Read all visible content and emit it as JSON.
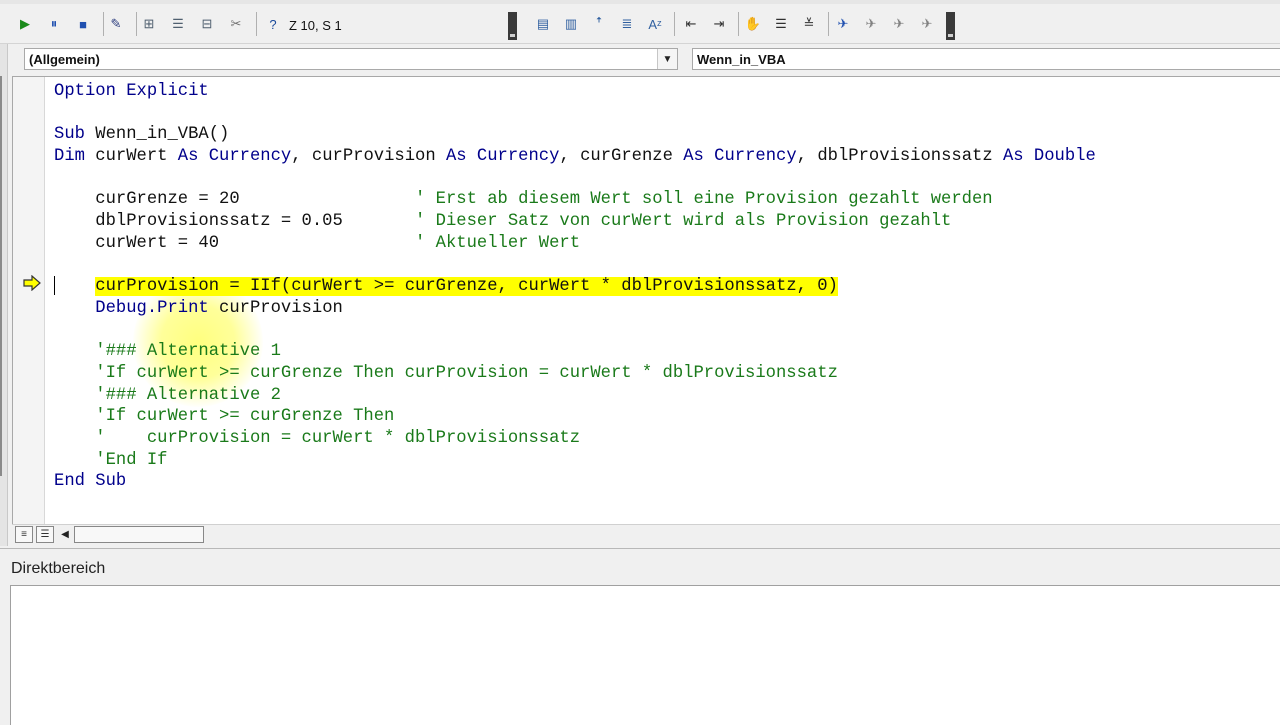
{
  "toolbar": {
    "position_indicator": "Z 10, S 1",
    "buttons_left": [
      {
        "name": "run-icon",
        "glyph": "▶",
        "color": "#1a8a1a"
      },
      {
        "name": "pause-icon",
        "glyph": "⏸",
        "color": "#2050b0"
      },
      {
        "name": "reset-icon",
        "glyph": "■",
        "color": "#2050b0"
      },
      {
        "name": "design-mode-icon",
        "glyph": "✎",
        "color": "#304080"
      },
      {
        "name": "project-explorer-icon",
        "glyph": "⊞",
        "color": "#506070"
      },
      {
        "name": "properties-icon",
        "glyph": "☰",
        "color": "#506070"
      },
      {
        "name": "object-browser-icon",
        "glyph": "⊟",
        "color": "#506070"
      },
      {
        "name": "toolbox-icon",
        "glyph": "✂",
        "color": "#707070"
      },
      {
        "name": "help-icon",
        "glyph": "?",
        "color": "#1a4a9a"
      }
    ],
    "buttons_right": [
      {
        "name": "list-properties-icon",
        "glyph": "▤",
        "color": "#3060a0"
      },
      {
        "name": "list-constants-icon",
        "glyph": "▥",
        "color": "#3060a0"
      },
      {
        "name": "quick-info-icon",
        "glyph": "ꜛ",
        "color": "#3060a0"
      },
      {
        "name": "parameter-info-icon",
        "glyph": "≣",
        "color": "#3060a0"
      },
      {
        "name": "complete-word-icon",
        "glyph": "Aᶻ",
        "color": "#3060a0"
      },
      {
        "name": "outdent-icon",
        "glyph": "⇤",
        "color": "#303030"
      },
      {
        "name": "indent-icon",
        "glyph": "⇥",
        "color": "#303030"
      },
      {
        "name": "toggle-breakpoint-icon",
        "glyph": "✋",
        "color": "#603010"
      },
      {
        "name": "comment-block-icon",
        "glyph": "☰",
        "color": "#303030"
      },
      {
        "name": "uncomment-block-icon",
        "glyph": "≚",
        "color": "#303030"
      },
      {
        "name": "toggle-bookmark-icon",
        "glyph": "✈",
        "color": "#2050b0"
      },
      {
        "name": "next-bookmark-icon",
        "glyph": "✈",
        "color": "#808080"
      },
      {
        "name": "previous-bookmark-icon",
        "glyph": "✈",
        "color": "#808080"
      },
      {
        "name": "clear-bookmarks-icon",
        "glyph": "✈",
        "color": "#808080"
      }
    ]
  },
  "module": {
    "object_combo": "(Allgemein)",
    "procedure_combo": "Wenn_in_VBA"
  },
  "code_lines": [
    [
      {
        "t": "Option Explicit",
        "c": "kw"
      }
    ],
    [],
    [
      {
        "t": "Sub ",
        "c": "kw"
      },
      {
        "t": "Wenn_in_VBA()",
        "c": ""
      }
    ],
    [
      {
        "t": "Dim ",
        "c": "kw"
      },
      {
        "t": "curWert ",
        "c": ""
      },
      {
        "t": "As Currency",
        "c": "kw"
      },
      {
        "t": ", curProvision ",
        "c": ""
      },
      {
        "t": "As Currency",
        "c": "kw"
      },
      {
        "t": ", curGrenze ",
        "c": ""
      },
      {
        "t": "As Currency",
        "c": "kw"
      },
      {
        "t": ", dblProvisionssatz ",
        "c": ""
      },
      {
        "t": "As Double",
        "c": "kw"
      }
    ],
    [],
    [
      {
        "t": "    curGrenze = 20                 ",
        "c": ""
      },
      {
        "t": "' Erst ab diesem Wert soll eine Provision gezahlt werden",
        "c": "cm"
      }
    ],
    [
      {
        "t": "    dblProvisionssatz = 0.05       ",
        "c": ""
      },
      {
        "t": "' Dieser Satz von curWert wird als Provision gezahlt",
        "c": "cm"
      }
    ],
    [
      {
        "t": "    curWert = 40                   ",
        "c": ""
      },
      {
        "t": "' Aktueller Wert",
        "c": "cm"
      }
    ],
    [],
    [
      {
        "t": "    ",
        "c": ""
      },
      {
        "t": "curProvision = IIf(curWert >= curGrenze, curWert * dblProvisionssatz, 0)",
        "c": "hl"
      }
    ],
    [
      {
        "t": "    ",
        "c": ""
      },
      {
        "t": "Debug.Print",
        "c": "kw"
      },
      {
        "t": " curProvision",
        "c": ""
      }
    ],
    [],
    [
      {
        "t": "    '### Alternative 1",
        "c": "cm"
      }
    ],
    [
      {
        "t": "    'If curWert >= curGrenze Then curProvision = curWert * dblProvisionssatz",
        "c": "cm"
      }
    ],
    [
      {
        "t": "    '### Alternative 2",
        "c": "cm"
      }
    ],
    [
      {
        "t": "    'If curWert >= curGrenze Then",
        "c": "cm"
      }
    ],
    [
      {
        "t": "    '    curProvision = curWert * dblProvisionssatz",
        "c": "cm"
      }
    ],
    [
      {
        "t": "    'End If",
        "c": "cm"
      }
    ],
    [
      {
        "t": "End Sub",
        "c": "kw"
      }
    ]
  ],
  "execution_line_index": 9,
  "immediate": {
    "title": "Direktbereich"
  },
  "colors": {
    "keyword": "#00008b",
    "comment": "#1a7a1a",
    "highlight": "#ffff00"
  }
}
